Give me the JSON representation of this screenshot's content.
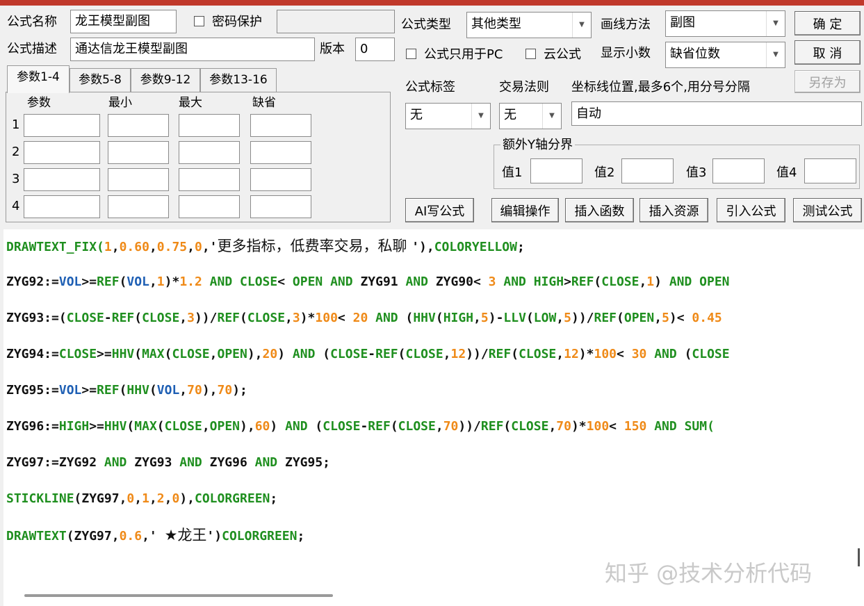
{
  "header": {
    "name_label": "公式名称",
    "name_value": "龙王模型副图",
    "password_label": "密码保护",
    "desc_label": "公式描述",
    "desc_value": "通达信龙王模型副图",
    "version_label": "版本",
    "version_value": "0",
    "type_label": "公式类型",
    "type_value": "其他类型",
    "draw_label": "画线方法",
    "draw_value": "副图",
    "pc_only_label": "公式只用于PC",
    "cloud_label": "云公式",
    "decimal_label": "显示小数",
    "decimal_value": "缺省位数"
  },
  "buttons": {
    "ok": "确  定",
    "cancel": "取  消",
    "save_as": "另存为"
  },
  "tabs": [
    "参数1-4",
    "参数5-8",
    "参数9-12",
    "参数13-16"
  ],
  "params": {
    "headers": [
      "参数",
      "最小",
      "最大",
      "缺省"
    ],
    "rows": [
      "1",
      "2",
      "3",
      "4"
    ]
  },
  "right": {
    "tag_label": "公式标签",
    "rule_label": "交易法则",
    "coord_label": "坐标线位置,最多6个,用分号分隔",
    "tag_value": "无",
    "rule_value": "无",
    "coord_value": "自动",
    "yaxis_group": "额外Y轴分界",
    "v1": "值1",
    "v2": "值2",
    "v3": "值3",
    "v4": "值4"
  },
  "actions": [
    "AI写公式",
    "编辑操作",
    "插入函数",
    "插入资源",
    "引入公式",
    "测试公式"
  ],
  "code_lines": [
    [
      [
        "k",
        "DRAWTEXT_FIX("
      ],
      [
        "o",
        "1"
      ],
      [
        "d",
        ","
      ],
      [
        "o",
        "0.60"
      ],
      [
        "d",
        ","
      ],
      [
        "o",
        "0.75"
      ],
      [
        "d",
        ","
      ],
      [
        "o",
        "0"
      ],
      [
        "d",
        ",'"
      ],
      [
        "cn",
        "更多指标，低费率交易，私聊 "
      ],
      [
        "d",
        "'),"
      ],
      [
        "k",
        "COLORYELLOW"
      ],
      [
        "d",
        ";"
      ]
    ],
    [
      [
        "d",
        "ZYG92:="
      ],
      [
        "b",
        "VOL"
      ],
      [
        "d",
        ">="
      ],
      [
        "k",
        "REF"
      ],
      [
        "d",
        "("
      ],
      [
        "b",
        "VOL"
      ],
      [
        "d",
        ","
      ],
      [
        "o",
        "1"
      ],
      [
        "d",
        ")*"
      ],
      [
        "o",
        "1.2"
      ],
      [
        "k",
        " AND "
      ],
      [
        "k",
        "CLOSE"
      ],
      [
        "d",
        "< "
      ],
      [
        "k",
        "OPEN"
      ],
      [
        "k",
        " AND "
      ],
      [
        "d",
        "ZYG91"
      ],
      [
        "k",
        " AND "
      ],
      [
        "d",
        "ZYG90< "
      ],
      [
        "o",
        "3"
      ],
      [
        "k",
        " AND "
      ],
      [
        "k",
        "HIGH"
      ],
      [
        "d",
        ">"
      ],
      [
        "k",
        "REF"
      ],
      [
        "d",
        "("
      ],
      [
        "k",
        "CLOSE"
      ],
      [
        "d",
        ","
      ],
      [
        "o",
        "1"
      ],
      [
        "d",
        ")"
      ],
      [
        "k",
        " AND "
      ],
      [
        "k",
        "OPEN"
      ]
    ],
    [
      [
        "d",
        "ZYG93:=("
      ],
      [
        "k",
        "CLOSE"
      ],
      [
        "d",
        "-"
      ],
      [
        "k",
        "REF"
      ],
      [
        "d",
        "("
      ],
      [
        "k",
        "CLOSE"
      ],
      [
        "d",
        ","
      ],
      [
        "o",
        "3"
      ],
      [
        "d",
        "))/"
      ],
      [
        "k",
        "REF"
      ],
      [
        "d",
        "("
      ],
      [
        "k",
        "CLOSE"
      ],
      [
        "d",
        ","
      ],
      [
        "o",
        "3"
      ],
      [
        "d",
        ")*"
      ],
      [
        "o",
        "100"
      ],
      [
        "d",
        "< "
      ],
      [
        "o",
        "20"
      ],
      [
        "k",
        " AND "
      ],
      [
        "d",
        "("
      ],
      [
        "k",
        "HHV"
      ],
      [
        "d",
        "("
      ],
      [
        "k",
        "HIGH"
      ],
      [
        "d",
        ","
      ],
      [
        "o",
        "5"
      ],
      [
        "d",
        ")-"
      ],
      [
        "k",
        "LLV"
      ],
      [
        "d",
        "("
      ],
      [
        "k",
        "LOW"
      ],
      [
        "d",
        ","
      ],
      [
        "o",
        "5"
      ],
      [
        "d",
        "))/"
      ],
      [
        "k",
        "REF"
      ],
      [
        "d",
        "("
      ],
      [
        "k",
        "OPEN"
      ],
      [
        "d",
        ","
      ],
      [
        "o",
        "5"
      ],
      [
        "d",
        ")< "
      ],
      [
        "o",
        "0.45"
      ]
    ],
    [
      [
        "d",
        "ZYG94:="
      ],
      [
        "k",
        "CLOSE"
      ],
      [
        "d",
        ">="
      ],
      [
        "k",
        "HHV"
      ],
      [
        "d",
        "("
      ],
      [
        "k",
        "MAX"
      ],
      [
        "d",
        "("
      ],
      [
        "k",
        "CLOSE"
      ],
      [
        "d",
        ","
      ],
      [
        "k",
        "OPEN"
      ],
      [
        "d",
        "),"
      ],
      [
        "o",
        "20"
      ],
      [
        "d",
        ")"
      ],
      [
        "k",
        " AND "
      ],
      [
        "d",
        "("
      ],
      [
        "k",
        "CLOSE"
      ],
      [
        "d",
        "-"
      ],
      [
        "k",
        "REF"
      ],
      [
        "d",
        "("
      ],
      [
        "k",
        "CLOSE"
      ],
      [
        "d",
        ","
      ],
      [
        "o",
        "12"
      ],
      [
        "d",
        "))/"
      ],
      [
        "k",
        "REF"
      ],
      [
        "d",
        "("
      ],
      [
        "k",
        "CLOSE"
      ],
      [
        "d",
        ","
      ],
      [
        "o",
        "12"
      ],
      [
        "d",
        ")*"
      ],
      [
        "o",
        "100"
      ],
      [
        "d",
        "< "
      ],
      [
        "o",
        "30"
      ],
      [
        "k",
        " AND "
      ],
      [
        "d",
        "("
      ],
      [
        "k",
        "CLOSE"
      ]
    ],
    [
      [
        "d",
        "ZYG95:="
      ],
      [
        "b",
        "VOL"
      ],
      [
        "d",
        ">="
      ],
      [
        "k",
        "REF"
      ],
      [
        "d",
        "("
      ],
      [
        "k",
        "HHV"
      ],
      [
        "d",
        "("
      ],
      [
        "b",
        "VOL"
      ],
      [
        "d",
        ","
      ],
      [
        "o",
        "70"
      ],
      [
        "d",
        "),"
      ],
      [
        "o",
        "70"
      ],
      [
        "d",
        ");"
      ]
    ],
    [
      [
        "d",
        "ZYG96:="
      ],
      [
        "k",
        "HIGH"
      ],
      [
        "d",
        ">="
      ],
      [
        "k",
        "HHV"
      ],
      [
        "d",
        "("
      ],
      [
        "k",
        "MAX"
      ],
      [
        "d",
        "("
      ],
      [
        "k",
        "CLOSE"
      ],
      [
        "d",
        ","
      ],
      [
        "k",
        "OPEN"
      ],
      [
        "d",
        "),"
      ],
      [
        "o",
        "60"
      ],
      [
        "d",
        ")"
      ],
      [
        "k",
        " AND "
      ],
      [
        "d",
        "("
      ],
      [
        "k",
        "CLOSE"
      ],
      [
        "d",
        "-"
      ],
      [
        "k",
        "REF"
      ],
      [
        "d",
        "("
      ],
      [
        "k",
        "CLOSE"
      ],
      [
        "d",
        ","
      ],
      [
        "o",
        "70"
      ],
      [
        "d",
        "))/"
      ],
      [
        "k",
        "REF"
      ],
      [
        "d",
        "("
      ],
      [
        "k",
        "CLOSE"
      ],
      [
        "d",
        ","
      ],
      [
        "o",
        "70"
      ],
      [
        "d",
        ")*"
      ],
      [
        "o",
        "100"
      ],
      [
        "d",
        "< "
      ],
      [
        "o",
        "150"
      ],
      [
        "k",
        " AND "
      ],
      [
        "k",
        "SUM("
      ]
    ],
    [
      [
        "d",
        "ZYG97:=ZYG92"
      ],
      [
        "k",
        " AND "
      ],
      [
        "d",
        "ZYG93"
      ],
      [
        "k",
        " AND "
      ],
      [
        "d",
        "ZYG96"
      ],
      [
        "k",
        " AND "
      ],
      [
        "d",
        "ZYG95;"
      ]
    ],
    [
      [
        "k",
        "STICKLINE"
      ],
      [
        "d",
        "(ZYG97,"
      ],
      [
        "o",
        "0"
      ],
      [
        "d",
        ","
      ],
      [
        "o",
        "1"
      ],
      [
        "d",
        ","
      ],
      [
        "o",
        "2"
      ],
      [
        "d",
        ","
      ],
      [
        "o",
        "0"
      ],
      [
        "d",
        "),"
      ],
      [
        "k",
        "COLORGREEN"
      ],
      [
        "d",
        ";"
      ]
    ],
    [
      [
        "k",
        "DRAWTEXT"
      ],
      [
        "d",
        "(ZYG97,"
      ],
      [
        "o",
        "0.6"
      ],
      [
        "d",
        ",' "
      ],
      [
        "cn",
        "★龙王"
      ],
      [
        "d",
        "')"
      ],
      [
        "k",
        "COLORGREEN"
      ],
      [
        "d",
        ";"
      ]
    ]
  ],
  "watermark": "知乎 @技术分析代码"
}
